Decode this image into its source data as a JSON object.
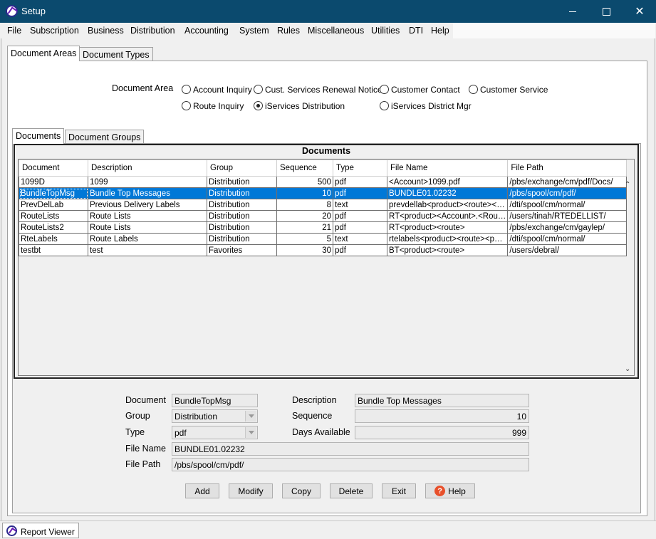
{
  "window": {
    "title": "Setup"
  },
  "menu": [
    "File",
    "Subscription",
    "Business",
    "Distribution",
    "Accounting",
    "System",
    "Rules",
    "Miscellaneous",
    "Utilities",
    "DTI",
    "Help"
  ],
  "top_tabs": [
    "Document Areas",
    "Document Types"
  ],
  "document_area": {
    "label": "Document Area",
    "options": [
      "Account Inquiry",
      "Cust. Services Renewal Notices",
      "Customer Contact",
      "Customer Service",
      "Route Inquiry",
      "iServices Distribution",
      "iServices District Mgr"
    ],
    "selected": "iServices Distribution"
  },
  "sub_tabs": [
    "Documents",
    "Document Groups"
  ],
  "grid": {
    "caption": "Documents",
    "columns": [
      "Document",
      "Description",
      "Group",
      "Sequence",
      "Type",
      "File Name",
      "File Path"
    ],
    "rows": [
      [
        "1099D",
        "1099",
        "Distribution",
        "500",
        "pdf",
        "<Account>1099.pdf",
        "/pbs/exchange/cm/pdf/Docs/"
      ],
      [
        "BundleTopMsg",
        "Bundle Top Messages",
        "Distribution",
        "10",
        "pdf",
        "BUNDLE01.02232",
        "/pbs/spool/cm/pdf/"
      ],
      [
        "PrevDelLab",
        "Previous Delivery Labels",
        "Distribution",
        "8",
        "text",
        "prevdellab<product><route><…",
        "/dti/spool/cm/normal/"
      ],
      [
        "RouteLists",
        "Route Lists",
        "Distribution",
        "20",
        "pdf",
        "RT<product><Account>.<Rou…",
        "/users/tinah/RTEDELLIST/"
      ],
      [
        "RouteLists2",
        "Route Lists",
        "Distribution",
        "21",
        "pdf",
        "RT<product><route>",
        "/pbs/exchange/cm/gaylep/"
      ],
      [
        "RteLabels",
        "Route Labels",
        "Distribution",
        "5",
        "text",
        "rtelabels<product><route><p…",
        "/dti/spool/cm/normal/"
      ],
      [
        "testbt",
        "test",
        "Favorites",
        "30",
        "pdf",
        "BT<product><route>",
        "/users/debral/"
      ]
    ],
    "selected_row": 1
  },
  "detail": {
    "document_label": "Document",
    "document_value": "BundleTopMsg",
    "group_label": "Group",
    "group_value": "Distribution",
    "type_label": "Type",
    "type_value": "pdf",
    "file_name_label": "File Name",
    "file_name_value": "BUNDLE01.02232",
    "file_path_label": "File Path",
    "file_path_value": "/pbs/spool/cm/pdf/",
    "description_label": "Description",
    "description_value": "Bundle Top Messages",
    "sequence_label": "Sequence",
    "sequence_value": "10",
    "days_label": "Days Available",
    "days_value": "999"
  },
  "buttons": {
    "add": "Add",
    "modify": "Modify",
    "copy": "Copy",
    "delete": "Delete",
    "exit": "Exit",
    "help": "Help"
  },
  "taskbar": {
    "item": "Report Viewer"
  },
  "icons": {
    "app": "app-logo-icon",
    "help": "help-question-icon"
  },
  "colors": {
    "titlebar": "#0b4a6e",
    "selection": "#0078d7",
    "help_icon": "#e8502b"
  }
}
